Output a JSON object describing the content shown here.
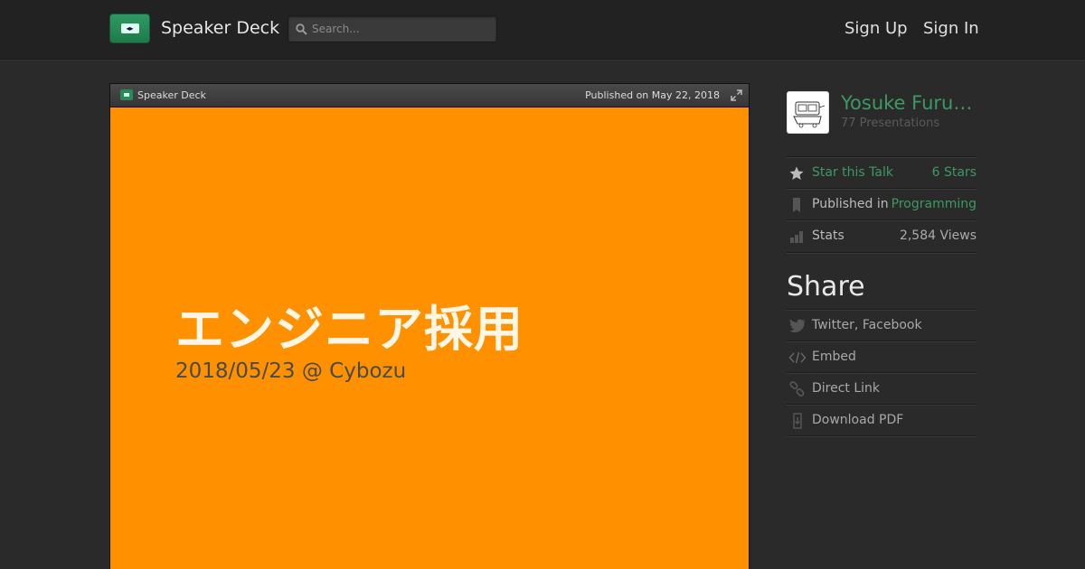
{
  "header": {
    "brand": "Speaker Deck",
    "search_placeholder": "Search...",
    "sign_up": "Sign Up",
    "sign_in": "Sign In"
  },
  "viewer": {
    "brand": "Speaker Deck",
    "published": "Published on May 22, 2018",
    "slide_title": "エンジニア採用",
    "slide_subtitle": "2018/05/23 @ Cybozu",
    "slide_bg": "#ff9100"
  },
  "author": {
    "name": "Yosuke Furuk...",
    "presentations": "77 Presentations"
  },
  "meta": {
    "star_label": "Star this Talk",
    "stars": "6 Stars",
    "published_label": "Published in",
    "category": "Programming",
    "stats_label": "Stats",
    "views": "2,584 Views"
  },
  "share": {
    "title": "Share",
    "items": [
      {
        "label": "Twitter, Facebook",
        "icon": "twitter-icon"
      },
      {
        "label": "Embed",
        "icon": "code-icon"
      },
      {
        "label": "Direct Link",
        "icon": "link-icon"
      },
      {
        "label": "Download PDF",
        "icon": "download-icon"
      }
    ]
  },
  "colors": {
    "accent": "#3b9a63",
    "background": "#2a2a2a",
    "header": "#222222"
  }
}
